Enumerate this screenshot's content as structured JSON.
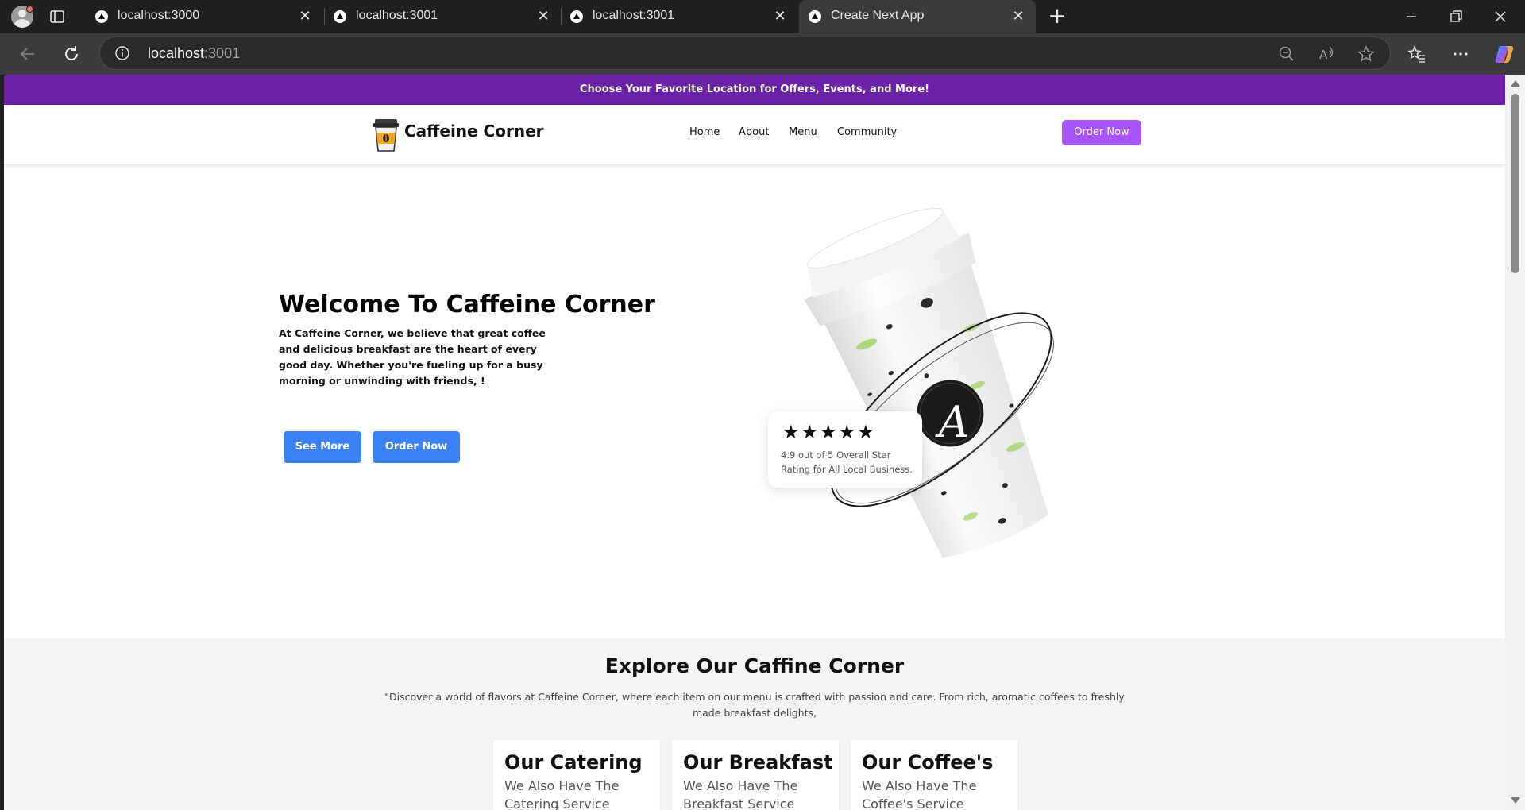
{
  "browser": {
    "tabs": [
      {
        "title": "localhost:3000",
        "active": false
      },
      {
        "title": "localhost:3001",
        "active": false
      },
      {
        "title": "localhost:3001",
        "active": false
      },
      {
        "title": "Create Next App",
        "active": true
      }
    ],
    "url_host": "localhost",
    "url_port": ":3001",
    "icons": [
      "profile-icon",
      "tab-actions-icon",
      "favicon-icon",
      "close-icon",
      "new-tab-icon",
      "minimize-icon",
      "restore-icon",
      "window-close-icon",
      "back-icon",
      "refresh-icon",
      "info-icon",
      "zoom-out-icon",
      "read-aloud-icon",
      "favorite-star-icon",
      "favorites-icon",
      "more-icon",
      "copilot-icon"
    ]
  },
  "page": {
    "promo": "Choose Your Favorite Location for Offers, Events, and More!",
    "brand": "Caffeine Corner",
    "nav": [
      "Home",
      "About",
      "Menu",
      "Community"
    ],
    "order_now_top": "Order Now",
    "hero": {
      "title": "Welcome To Caffeine Corner",
      "text": "At Caffeine Corner, we believe that great coffee and delicious breakfast are the heart of every good day. Whether you're fueling up for a busy morning or unwinding with friends, !",
      "see_more": "See More",
      "order_now": "Order Now"
    },
    "rating": {
      "stars": "★★★★★",
      "star_count": 5,
      "text": "4.9 out of 5 Overall Star Rating for All Local Business."
    },
    "cup_logo_letter": "A",
    "explore": {
      "title": "Explore Our Caffine Corner",
      "text": "\"Discover a world of flavors at Caffeine Corner, where each item on our menu is crafted with passion and care. From rich, aromatic coffees to freshly made breakfast delights,",
      "cards": [
        {
          "title": "Our Catering",
          "subtitle": "We Also Have The Catering Service"
        },
        {
          "title": "Our Breakfast",
          "subtitle": "We Also Have The Breakfast Service"
        },
        {
          "title": "Our Coffee's",
          "subtitle": "We Also Have The Coffee's Service"
        }
      ]
    }
  },
  "colors": {
    "promo_bg": "#6b21a8",
    "order_button": "#a855f7",
    "hero_buttons": "#3b82f6",
    "explore_bg": "#f3f4f6",
    "chrome_dark": "#202020",
    "chrome_toolbar": "#3b3b3b"
  }
}
